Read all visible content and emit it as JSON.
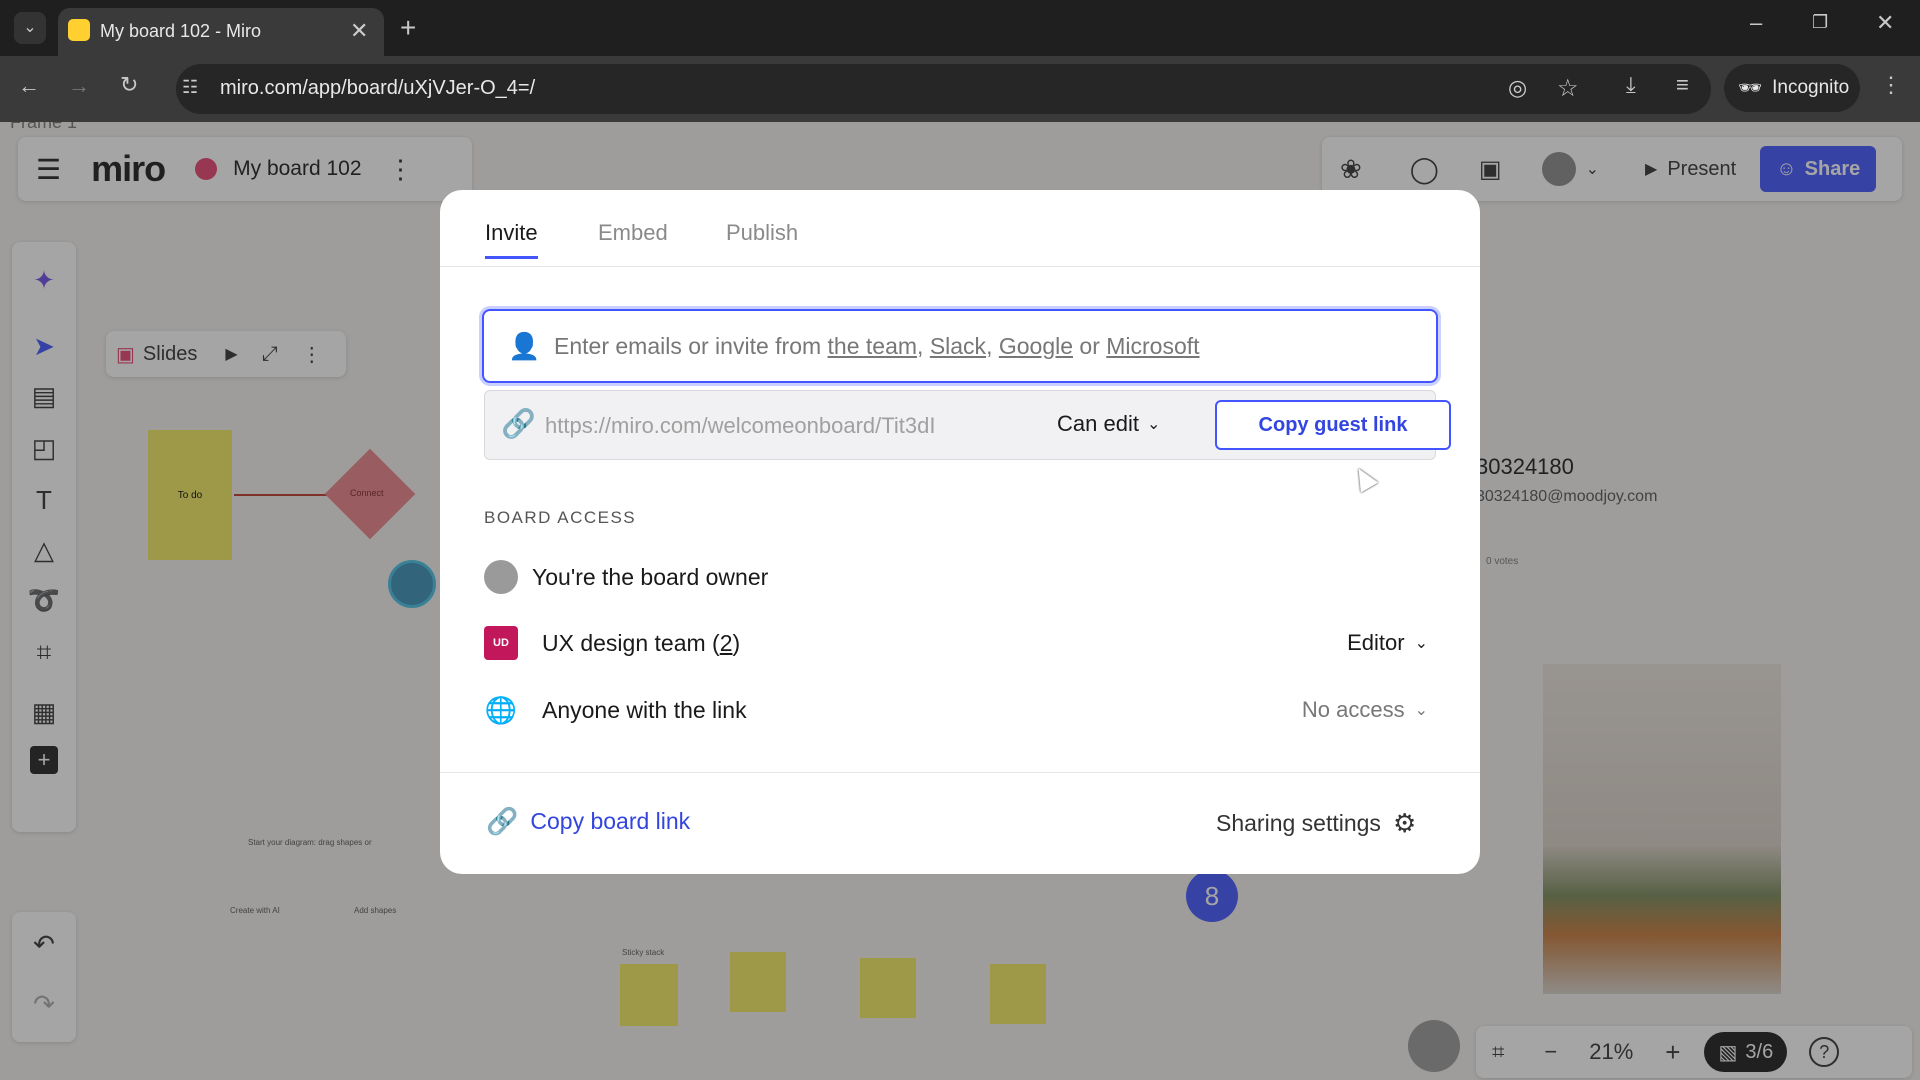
{
  "browser": {
    "tab_title": "My board 102 - Miro",
    "new_tab": "+",
    "url": "miro.com/app/board/uXjVJer-O_4=/",
    "incognito_label": "Incognito"
  },
  "board": {
    "frame_label": "Frame 1",
    "logo": "miro",
    "board_name": "My board 102",
    "present_label": "Present",
    "share_label": "Share",
    "slides_label": "Slides",
    "user_id_partial": "30324180",
    "user_email_partial": "30324180@moodjoy.com",
    "votes": "0 votes",
    "sticky_label": "To do",
    "diamond_label": "Connect",
    "diagram_hint": "Start your diagram: drag shapes or",
    "create_ai": "Create with AI",
    "add_shapes": "Add shapes",
    "sticky_stack": "Sticky stack",
    "badge_count": "8",
    "zoom": "21%",
    "pages": "3/6"
  },
  "modal": {
    "tabs": [
      "Invite",
      "Embed",
      "Publish"
    ],
    "invite_prefix": "Enter emails or invite from ",
    "invite_links": [
      "the team",
      "Slack",
      "Google",
      "Microsoft"
    ],
    "invite_sep1": ", ",
    "invite_sep2": ", ",
    "invite_or": " or ",
    "guest_link": "https://miro.com/welcomeonboard/Tit3dI",
    "can_edit": "Can edit",
    "copy_guest_link": "Copy guest link",
    "board_access_heading": "BOARD ACCESS",
    "owner_text": "You're the board owner",
    "team_badge": "UD",
    "team_name": "UX design team (",
    "team_count": "2",
    "team_close": ")",
    "team_role": "Editor",
    "anyone_text": "Anyone with the link",
    "anyone_role": "No access",
    "copy_board_link": "Copy board link",
    "sharing_settings": "Sharing settings"
  },
  "colors": {
    "accent": "#4255ff",
    "team_badge_bg": "#c2185b"
  }
}
